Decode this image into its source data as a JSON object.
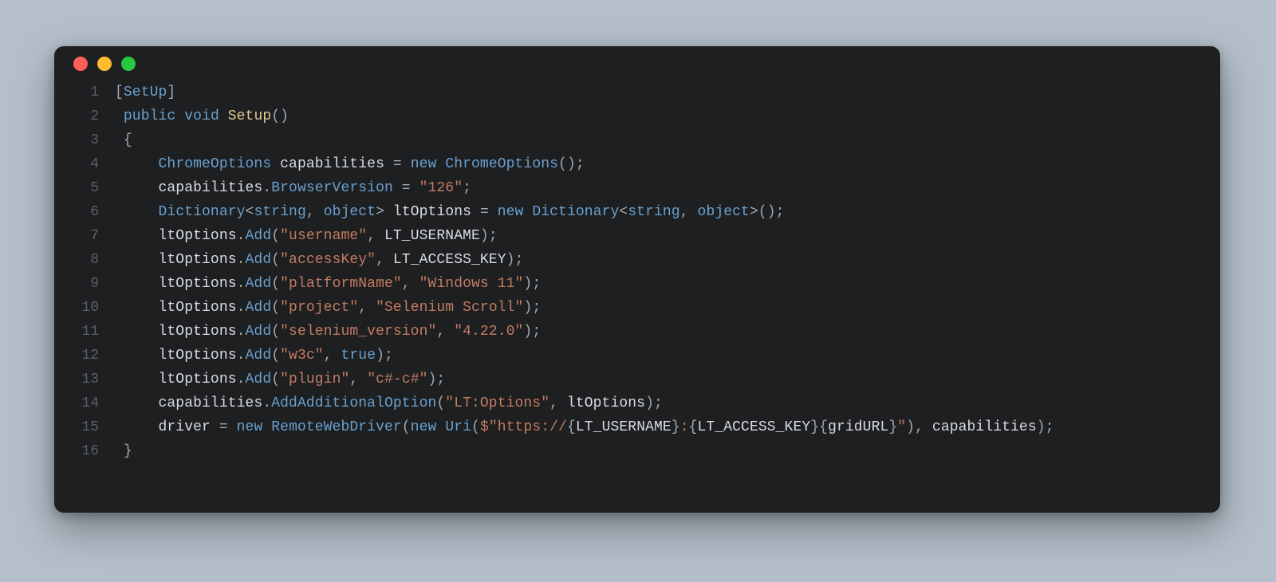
{
  "window": {
    "traffic_lights": {
      "close": "#ff5f57",
      "minimize": "#febc2e",
      "zoom": "#28c840"
    }
  },
  "code": {
    "lines": [
      {
        "n": 1,
        "tokens": [
          [
            "[",
            "punct"
          ],
          [
            "SetUp",
            "type"
          ],
          [
            "]",
            "punct"
          ]
        ]
      },
      {
        "n": 2,
        "tokens": [
          [
            " ",
            "default"
          ],
          [
            "public",
            "keyword"
          ],
          [
            " ",
            "default"
          ],
          [
            "void",
            "keyword"
          ],
          [
            " ",
            "default"
          ],
          [
            "Setup",
            "funcdef"
          ],
          [
            "()",
            "punct"
          ]
        ]
      },
      {
        "n": 3,
        "tokens": [
          [
            " {",
            "punct"
          ]
        ]
      },
      {
        "n": 4,
        "tokens": [
          [
            "     ",
            "default"
          ],
          [
            "ChromeOptions",
            "type"
          ],
          [
            " capabilities ",
            "default"
          ],
          [
            "=",
            "punct"
          ],
          [
            " ",
            "default"
          ],
          [
            "new",
            "keyword"
          ],
          [
            " ",
            "default"
          ],
          [
            "ChromeOptions",
            "type"
          ],
          [
            "();",
            "punct"
          ]
        ]
      },
      {
        "n": 5,
        "tokens": [
          [
            "     capabilities",
            "default"
          ],
          [
            ".",
            "punct"
          ],
          [
            "BrowserVersion",
            "func"
          ],
          [
            " ",
            "default"
          ],
          [
            "=",
            "punct"
          ],
          [
            " ",
            "default"
          ],
          [
            "\"126\"",
            "string"
          ],
          [
            ";",
            "punct"
          ]
        ]
      },
      {
        "n": 6,
        "tokens": [
          [
            "     ",
            "default"
          ],
          [
            "Dictionary",
            "type"
          ],
          [
            "<",
            "punct"
          ],
          [
            "string",
            "typearg"
          ],
          [
            ",",
            "punct"
          ],
          [
            " ",
            "default"
          ],
          [
            "object",
            "typearg"
          ],
          [
            ">",
            "punct"
          ],
          [
            " ltOptions ",
            "default"
          ],
          [
            "=",
            "punct"
          ],
          [
            " ",
            "default"
          ],
          [
            "new",
            "keyword"
          ],
          [
            " ",
            "default"
          ],
          [
            "Dictionary",
            "type"
          ],
          [
            "<",
            "punct"
          ],
          [
            "string",
            "typearg"
          ],
          [
            ",",
            "punct"
          ],
          [
            " ",
            "default"
          ],
          [
            "object",
            "typearg"
          ],
          [
            ">();",
            "punct"
          ]
        ]
      },
      {
        "n": 7,
        "tokens": [
          [
            "     ltOptions",
            "default"
          ],
          [
            ".",
            "punct"
          ],
          [
            "Add",
            "func"
          ],
          [
            "(",
            "punct"
          ],
          [
            "\"username\"",
            "string"
          ],
          [
            ",",
            "punct"
          ],
          [
            " LT_USERNAME",
            "default"
          ],
          [
            ");",
            "punct"
          ]
        ]
      },
      {
        "n": 8,
        "tokens": [
          [
            "     ltOptions",
            "default"
          ],
          [
            ".",
            "punct"
          ],
          [
            "Add",
            "func"
          ],
          [
            "(",
            "punct"
          ],
          [
            "\"accessKey\"",
            "string"
          ],
          [
            ",",
            "punct"
          ],
          [
            " LT_ACCESS_KEY",
            "default"
          ],
          [
            ");",
            "punct"
          ]
        ]
      },
      {
        "n": 9,
        "tokens": [
          [
            "     ltOptions",
            "default"
          ],
          [
            ".",
            "punct"
          ],
          [
            "Add",
            "func"
          ],
          [
            "(",
            "punct"
          ],
          [
            "\"platformName\"",
            "string"
          ],
          [
            ",",
            "punct"
          ],
          [
            " ",
            "default"
          ],
          [
            "\"Windows 11\"",
            "string"
          ],
          [
            ");",
            "punct"
          ]
        ]
      },
      {
        "n": 10,
        "tokens": [
          [
            "     ltOptions",
            "default"
          ],
          [
            ".",
            "punct"
          ],
          [
            "Add",
            "func"
          ],
          [
            "(",
            "punct"
          ],
          [
            "\"project\"",
            "string"
          ],
          [
            ",",
            "punct"
          ],
          [
            " ",
            "default"
          ],
          [
            "\"Selenium Scroll\"",
            "string"
          ],
          [
            ");",
            "punct"
          ]
        ]
      },
      {
        "n": 11,
        "tokens": [
          [
            "     ltOptions",
            "default"
          ],
          [
            ".",
            "punct"
          ],
          [
            "Add",
            "func"
          ],
          [
            "(",
            "punct"
          ],
          [
            "\"selenium_version\"",
            "string"
          ],
          [
            ",",
            "punct"
          ],
          [
            " ",
            "default"
          ],
          [
            "\"4.22.0\"",
            "string"
          ],
          [
            ");",
            "punct"
          ]
        ]
      },
      {
        "n": 12,
        "tokens": [
          [
            "     ltOptions",
            "default"
          ],
          [
            ".",
            "punct"
          ],
          [
            "Add",
            "func"
          ],
          [
            "(",
            "punct"
          ],
          [
            "\"w3c\"",
            "string"
          ],
          [
            ",",
            "punct"
          ],
          [
            " ",
            "default"
          ],
          [
            "true",
            "bool"
          ],
          [
            ");",
            "punct"
          ]
        ]
      },
      {
        "n": 13,
        "tokens": [
          [
            "     ltOptions",
            "default"
          ],
          [
            ".",
            "punct"
          ],
          [
            "Add",
            "func"
          ],
          [
            "(",
            "punct"
          ],
          [
            "\"plugin\"",
            "string"
          ],
          [
            ",",
            "punct"
          ],
          [
            " ",
            "default"
          ],
          [
            "\"c#-c#\"",
            "string"
          ],
          [
            ");",
            "punct"
          ]
        ]
      },
      {
        "n": 14,
        "tokens": [
          [
            "     capabilities",
            "default"
          ],
          [
            ".",
            "punct"
          ],
          [
            "AddAdditionalOption",
            "func"
          ],
          [
            "(",
            "punct"
          ],
          [
            "\"LT:Options\"",
            "string"
          ],
          [
            ",",
            "punct"
          ],
          [
            " ltOptions",
            "default"
          ],
          [
            ");",
            "punct"
          ]
        ]
      },
      {
        "n": 15,
        "tokens": [
          [
            "     driver ",
            "default"
          ],
          [
            "=",
            "punct"
          ],
          [
            " ",
            "default"
          ],
          [
            "new",
            "keyword"
          ],
          [
            " ",
            "default"
          ],
          [
            "RemoteWebDriver",
            "type"
          ],
          [
            "(",
            "punct"
          ],
          [
            "new",
            "keyword"
          ],
          [
            " ",
            "default"
          ],
          [
            "Uri",
            "type"
          ],
          [
            "(",
            "punct"
          ],
          [
            "$\"https://",
            "string"
          ],
          [
            "{",
            "punct"
          ],
          [
            "LT_USERNAME",
            "interp"
          ],
          [
            "}",
            "punct"
          ],
          [
            ":",
            "string"
          ],
          [
            "{",
            "punct"
          ],
          [
            "LT_ACCESS_KEY",
            "interp"
          ],
          [
            "}",
            "punct"
          ],
          [
            "{",
            "punct"
          ],
          [
            "gridURL",
            "interp"
          ],
          [
            "}",
            "punct"
          ],
          [
            "\"",
            "string"
          ],
          [
            "),",
            "punct"
          ],
          [
            " capabilities",
            "default"
          ],
          [
            ");",
            "punct"
          ]
        ]
      },
      {
        "n": 16,
        "tokens": [
          [
            " }",
            "punct"
          ]
        ]
      }
    ]
  }
}
